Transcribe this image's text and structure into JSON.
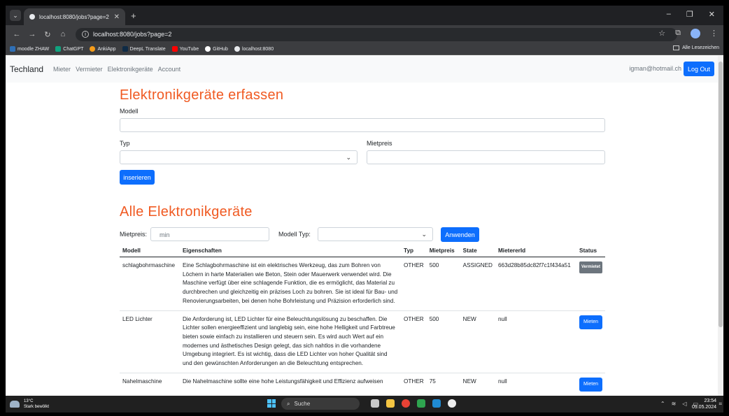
{
  "browser": {
    "tab_title": "localhost:8080/jobs?page=2",
    "url": "localhost:8080/jobs?page=2",
    "bookmarks": [
      {
        "label": "moodle ZHAW",
        "color": "#2f6fb5"
      },
      {
        "label": "ChatGPT",
        "color": "#10a37f"
      },
      {
        "label": "AnkiApp",
        "color": "#f59c1a"
      },
      {
        "label": "DeepL Translate",
        "color": "#0f2b46"
      },
      {
        "label": "YouTube",
        "color": "#ff0000"
      },
      {
        "label": "GitHub",
        "color": "#ffffff"
      },
      {
        "label": "localhost:8080",
        "color": "#e8eaed"
      }
    ],
    "all_bookmarks": "Alle Lesezeichen"
  },
  "navbar": {
    "brand": "Techland",
    "links": [
      "Mieter",
      "Vermieter",
      "Elektronikgeräte",
      "Account"
    ],
    "user": "igman@hotmail.ch",
    "logout": "Log Out"
  },
  "form": {
    "title": "Elektronikgeräte erfassen",
    "modell_label": "Modell",
    "typ_label": "Typ",
    "mietpreis_label": "Mietpreis",
    "submit": "inserieren"
  },
  "list": {
    "title": "Alle Elektronikgeräte",
    "filter_mietpreis_label": "Mietpreis:",
    "filter_mietpreis_placeholder": "min",
    "filter_typ_label": "Modell Typ:",
    "apply": "Anwenden",
    "columns": [
      "Modell",
      "Eigenschaften",
      "Typ",
      "Mietpreis",
      "State",
      "MietererId",
      "Status"
    ],
    "rows": [
      {
        "modell": "schlagbohrmaschine",
        "eigenschaften": "Eine Schlagbohrmaschine ist ein elektrisches Werkzeug, das zum Bohren von Löchern in harte Materialien wie Beton, Stein oder Mauerwerk verwendet wird. Die Maschine verfügt über eine schlagende Funktion, die es ermöglicht, das Material zu durchbrechen und gleichzeitig ein präzises Loch zu bohren. Sie ist ideal für Bau- und Renovierungsarbeiten, bei denen hohe Bohrleistung und Präzision erforderlich sind.",
        "typ": "OTHER",
        "mietpreis": "500",
        "state": "ASSIGNED",
        "mietererid": "663d28b85dc82f7c1f434a51",
        "status": "Vermietet"
      },
      {
        "modell": "LED Lichter",
        "eigenschaften": "Die Anforderung ist, LED Lichter für eine Beleuchtungslösung zu beschaffen. Die Lichter sollen energieeffizient und langlebig sein, eine hohe Helligkeit und Farbtreue bieten sowie einfach zu installieren und steuern sein. Es wird auch Wert auf ein modernes und ästhetisches Design gelegt, das sich nahtlos in die vorhandene Umgebung integriert. Es ist wichtig, dass die LED Lichter von hoher Qualität sind und den gewünschten Anforderungen an die Beleuchtung entsprechen.",
        "typ": "OTHER",
        "mietpreis": "500",
        "state": "NEW",
        "mietererid": "null",
        "status": "Mieten"
      },
      {
        "modell": "Nahelmaschine",
        "eigenschaften": "Die Nahelmaschine sollte eine hohe Leistungsfähigkeit und Effizienz aufweisen",
        "typ": "OTHER",
        "mietpreis": "75",
        "state": "NEW",
        "mietererid": "null",
        "status": "Mieten"
      }
    ]
  },
  "taskbar": {
    "temp": "13°C",
    "weather": "Stark bewölkt",
    "search": "Suche",
    "time": "23:54",
    "date": "09.05.2024"
  }
}
